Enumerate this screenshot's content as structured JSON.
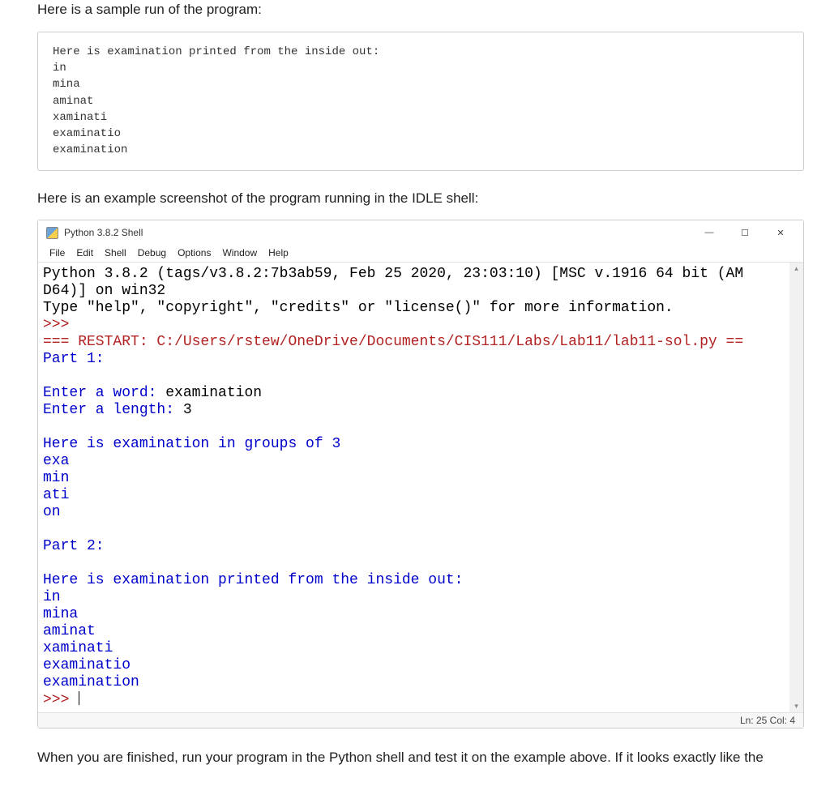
{
  "intro1": "Here is a sample run of the program:",
  "codeblock": "Here is examination printed from the inside out:\nin\nmina\naminat\nxaminati\nexaminatio\nexamination",
  "intro2": "Here is an example screenshot of the program running in the IDLE shell:",
  "idle": {
    "title": "Python 3.8.2 Shell",
    "controls": {
      "minimize": "—",
      "maximize": "☐",
      "close": "✕"
    },
    "menu": [
      "File",
      "Edit",
      "Shell",
      "Debug",
      "Options",
      "Window",
      "Help"
    ],
    "shell": {
      "banner1": "Python 3.8.2 (tags/v3.8.2:7b3ab59, Feb 25 2020, 23:03:10) [MSC v.1916 64 bit (AM",
      "banner2": "D64)] on win32",
      "banner3": "Type \"help\", \"copyright\", \"credits\" or \"license()\" for more information.",
      "prompt1": ">>> ",
      "restart": "=== RESTART: C:/Users/rstew/OneDrive/Documents/CIS111/Labs/Lab11/lab11-sol.py ==",
      "part1": "Part 1:",
      "blank": "",
      "enter_word_lbl": "Enter a word: ",
      "enter_word_val": "examination",
      "enter_len_lbl": "Enter a length: ",
      "enter_len_val": "3",
      "groups_hdr": "Here is examination in groups of 3",
      "g1": "exa",
      "g2": "min",
      "g3": "ati",
      "g4": "on",
      "part2": "Part 2:",
      "inside_out_hdr": "Here is examination printed from the inside out:",
      "o1": "in",
      "o2": "mina",
      "o3": "aminat",
      "o4": "xaminati",
      "o5": "examinatio",
      "o6": "examination",
      "prompt2": ">>> "
    },
    "status": "Ln: 25  Col: 4",
    "scroll": {
      "up": "▴",
      "down": "▾"
    }
  },
  "outro": "When you are finished, run your program in the Python shell and test it on the example above. If it looks exactly like the"
}
